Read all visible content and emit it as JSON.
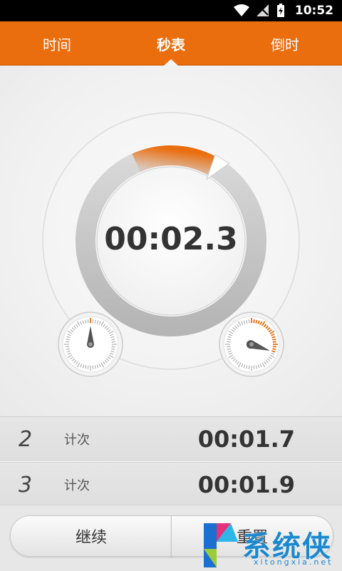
{
  "status_bar": {
    "time": "10:52",
    "icons": [
      "wifi-icon",
      "signal-off-icon",
      "battery-charging-icon"
    ]
  },
  "tabs": [
    {
      "label": "时间",
      "active": false
    },
    {
      "label": "秒表",
      "active": true
    },
    {
      "label": "倒时",
      "active": false
    }
  ],
  "stopwatch": {
    "elapsed": "00:02.3",
    "progress": 0.15,
    "accent_color": "#ea6d0e",
    "left_subdial": "minute-subdial",
    "right_subdial": "second-subdial"
  },
  "laps": [
    {
      "number": "2",
      "label": "计次",
      "time": "00:01.7"
    },
    {
      "number": "3",
      "label": "计次",
      "time": "00:01.9"
    }
  ],
  "actions": {
    "continue_label": "继续",
    "reset_label": "重置"
  },
  "watermark": {
    "brand": "系统侠",
    "url": "xitongxia.net"
  }
}
